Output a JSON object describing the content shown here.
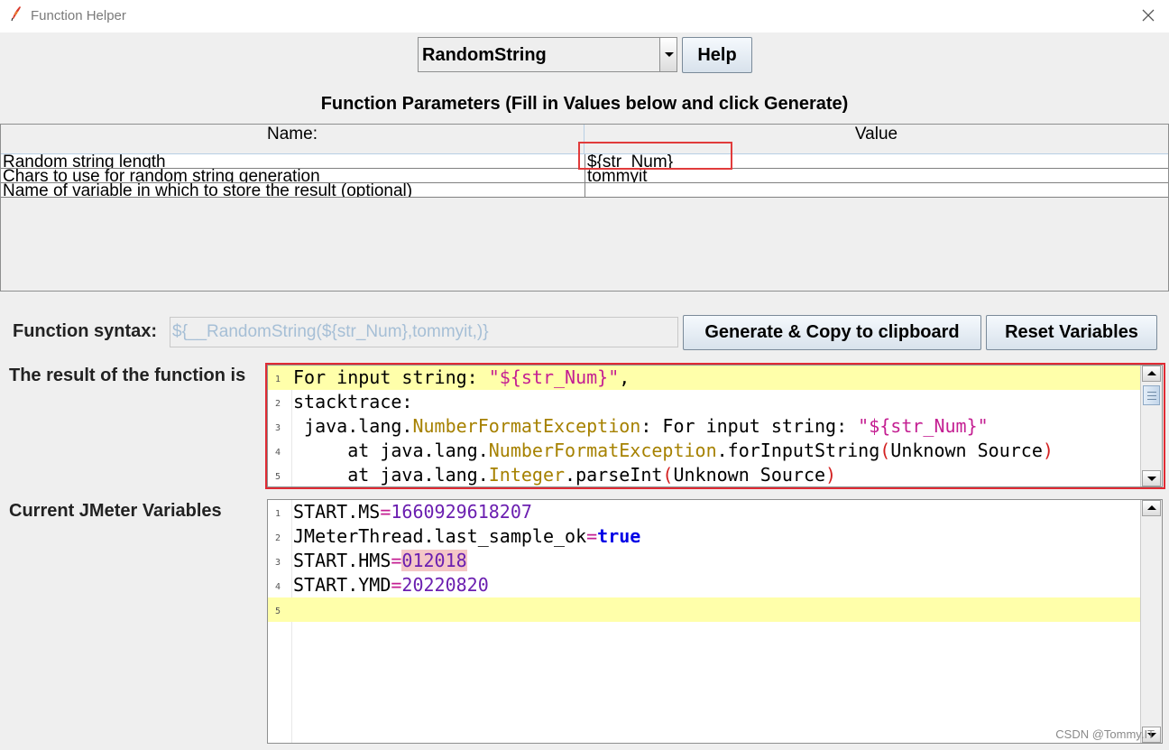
{
  "window": {
    "title": "Function Helper"
  },
  "function_select": {
    "value": "RandomString"
  },
  "help_button": "Help",
  "params": {
    "title": "Function Parameters (Fill in Values below and click Generate)",
    "columns": [
      "Name:",
      "Value"
    ],
    "rows": [
      {
        "name": "Random string length",
        "value": "${str_Num}"
      },
      {
        "name": "Chars to use for random string generation",
        "value": "tommyit"
      },
      {
        "name": "Name of variable in which to store the result (optional)",
        "value": ""
      }
    ]
  },
  "syntax": {
    "label": "Function syntax:",
    "value": "${__RandomString(${str_Num},tommyit,)}"
  },
  "buttons": {
    "generate": "Generate & Copy to clipboard",
    "reset": "Reset Variables"
  },
  "result": {
    "label": "The result of the function is",
    "line_numbers": [
      "1",
      "2",
      "3",
      "4",
      "5"
    ],
    "lines": {
      "l1_text": "For input string: ",
      "l1_str": "\"${str_Num}\"",
      "l1_end": ",",
      "l2_text": "stacktrace:",
      "l3_pkg": " java.lang.",
      "l3_cls": "NumberFormatException",
      "l3_text": ": For input string: ",
      "l3_str": "\"${str_Num}\"",
      "l4_pre": "     at java.lang.",
      "l4_cls": "NumberFormatException",
      "l4_method": ".forInputString",
      "l4_open": "(",
      "l4_src": "Unknown Source",
      "l4_close": ")",
      "l5_pre": "     at java.lang.",
      "l5_cls": "Integer",
      "l5_method": ".parseInt",
      "l5_open": "(",
      "l5_src": "Unknown Source",
      "l5_close": ")"
    }
  },
  "variables": {
    "label": "Current JMeter Variables",
    "line_numbers": [
      "1",
      "2",
      "3",
      "4",
      "5"
    ],
    "entries": [
      {
        "key": "START.MS",
        "eq": "=",
        "value": "1660929618207"
      },
      {
        "key": "JMeterThread.last_sample_ok",
        "eq": "=",
        "value": "true"
      },
      {
        "key": "START.HMS",
        "eq": "=",
        "value": "012018"
      },
      {
        "key": "START.YMD",
        "eq": "=",
        "value": "20220820"
      }
    ]
  },
  "watermark": "CSDN @Tommy.IT",
  "colors": {
    "highlight_box": "#e13b3b",
    "result_frame": "#e02b34",
    "current_line": "#ffffaa",
    "string": "#c41f92",
    "class": "#a68100",
    "number": "#6b1fb0",
    "keyword": "#0000e6"
  },
  "icons": {
    "app": "feather-icon",
    "close": "close-icon"
  }
}
